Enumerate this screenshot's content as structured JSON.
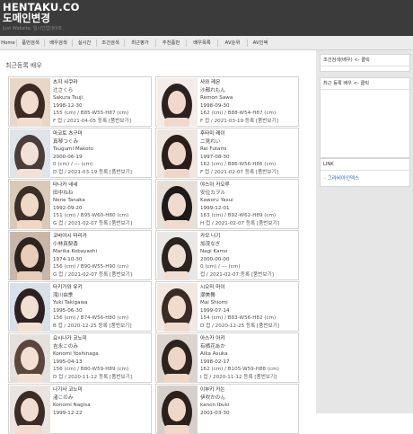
{
  "header": {
    "site_title": "HENTAKU.CO",
    "site_subtitle": "도메인변경",
    "tagline": "Just Website. 일시인업데이트."
  },
  "nav": {
    "items": [
      {
        "label": "Home"
      },
      {
        "label": "품번검색"
      },
      {
        "label": "배우검색"
      },
      {
        "label": "실시간"
      },
      {
        "label": "조건검색"
      },
      {
        "label": "최근평가"
      },
      {
        "label": "추천품번"
      },
      {
        "label": "배우목록"
      },
      {
        "label": "AV순위"
      },
      {
        "label": "AV인덱"
      }
    ]
  },
  "main": {
    "section_title": "최근등록 배우"
  },
  "actresses": [
    {
      "name_ko": "츠지 사쿠라",
      "name_jp": "辻さくら",
      "name_en": "Sakura Tsuji",
      "dob": "1998-12-30",
      "stats": "155 (cm) / B85-W55-H87 (cm)",
      "meta": "F 컵 / 2021-04-05 등록 [품번보기]"
    },
    {
      "name_ko": "사와 레몬",
      "name_jp": "沙都れもん",
      "name_en": "Remon Sawa",
      "dob": "1998-09-30",
      "stats": "162 (cm) / B88-W54-H87 (cm)",
      "meta": "F 컵 / 2021-03-19 등록 [품번보기]"
    },
    {
      "name_ko": "마코토 츠구미",
      "name_jp": "真琴つぐみ",
      "name_en": "Tsugumi Makoto",
      "dob": "2000-06-19",
      "stats": "0 (cm) / --- (cm)",
      "meta": "D 컵 / 2021-03-19 등록 [품번보기]"
    },
    {
      "name_ko": "후타미 레이",
      "name_jp": "二見れい",
      "name_en": "Rei Futami",
      "dob": "1997-08-30",
      "stats": "162 (cm) / B86-W56-H86 (cm)",
      "meta": "F 컵 / 2021-02-07 등록 [품번보기]"
    },
    {
      "name_ko": "타나카 네네",
      "name_jp": "田中ねね",
      "name_en": "Nene Tanaka",
      "dob": "1992-09-20",
      "stats": "151 (cm) / B95-W60-H80 (cm)",
      "meta": "G 컵 / 2021-02-07 등록 [품번보기]"
    },
    {
      "name_ko": "야스이 카오루",
      "name_jp": "安位カヲル",
      "name_en": "Kaworu Yasui",
      "dob": "1999-12-01",
      "stats": "163 (cm) / B92-W62-H89 (cm)",
      "meta": "H 컵 / 2021-02-07 등록 [품번보기]"
    },
    {
      "name_ko": "코바야시 마리카",
      "name_jp": "小林真梨香",
      "name_en": "Marika Kobayashi",
      "dob": "1974-10-30",
      "stats": "156 (cm) / B90-W55-H90 (cm)",
      "meta": "G 컵 / 2021-02-07 등록 [품번보기]"
    },
    {
      "name_ko": "카모 나기",
      "name_jp": "加茂なぎ",
      "name_en": "Nagi Kamo",
      "dob": "2000-00-00",
      "stats": "0 (cm) / --- (cm)",
      "meta": "컵 / 2021-02-07 등록 [품번보기]"
    },
    {
      "name_ko": "타키가와 유키",
      "name_jp": "滝川由季",
      "name_en": "Yuki Takigawa",
      "dob": "1995-06-30",
      "stats": "156 (cm) / B74-W56-H80 (cm)",
      "meta": "B 컵 / 2020-12-25 등록 [품번보기]"
    },
    {
      "name_ko": "시오미 마이",
      "name_jp": "潮美舞",
      "name_en": "Mai Shiomi",
      "dob": "1999-07-14",
      "stats": "154 (cm) / B83-W56-H82 (cm)",
      "meta": "D 컵 / 2020-12-25 등록 [품번보기]"
    },
    {
      "name_ko": "요시나가 코노미",
      "name_jp": "吉永このみ",
      "name_en": "Konomi Yoshinaga",
      "dob": "1995-04-13",
      "stats": "156 (cm) / B80-W59-H89 (cm)",
      "meta": "D 컵 / 2020-11-12 등록 [품번보기]"
    },
    {
      "name_ko": "아스카 아카",
      "name_jp": "有栖花あか",
      "name_en": "Aika Asuka",
      "dob": "1998-02-17",
      "stats": "162 (cm) / B105-W59-H88 (cm)",
      "meta": "I 컵 / 2020-11-12 등록 [품번보기]"
    },
    {
      "name_ko": "나기사 코노미",
      "name_jp": "渚このみ",
      "name_en": "Konomi Nagisa",
      "dob": "1999-12-22",
      "stats": "",
      "meta": ""
    },
    {
      "name_ko": "이부키 카논",
      "name_jp": "伊吹かのん",
      "name_en": "kanon Ibuki",
      "dob": "2001-03-30",
      "stats": "",
      "meta": ""
    }
  ],
  "sidebar": {
    "panel1_title": "조건검색(배우) <- 클릭",
    "panel2_title": "최근 등록 배우 <- 클릭",
    "panel3_title": "LINK",
    "link_label": "그라비아인덱스"
  },
  "colors": {
    "header_bg": "#3b3b3b",
    "nav_bg": "#ececec",
    "sidebar_bg": "#e6e6e6",
    "link": "#2d6ab3"
  }
}
